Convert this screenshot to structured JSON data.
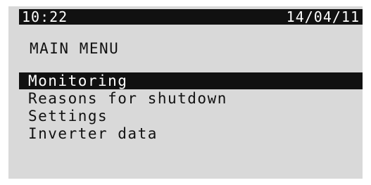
{
  "status_bar": {
    "time": "10:22",
    "date": "14/04/11"
  },
  "menu": {
    "title": "MAIN MENU",
    "items": [
      {
        "label": "Monitoring",
        "selected": true
      },
      {
        "label": "Reasons for shutdown",
        "selected": false
      },
      {
        "label": "Settings",
        "selected": false
      },
      {
        "label": "Inverter data",
        "selected": false
      }
    ]
  },
  "colors": {
    "screen_background": "#d9d9d9",
    "highlight": "#111111",
    "text": "#111111",
    "highlight_text": "#ffffff"
  }
}
